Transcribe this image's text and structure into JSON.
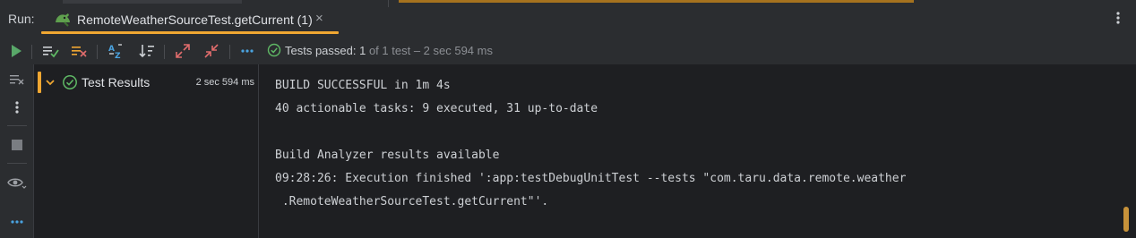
{
  "run_header": {
    "label": "Run:",
    "tab": {
      "title": "RemoteWeatherSourceTest.getCurrent (1)",
      "icon": "android-test-icon",
      "close_glyph": "×"
    },
    "menu_icon": "kebab-menu-icon"
  },
  "toolbar": {
    "buttons": [
      {
        "name": "rerun-button",
        "icon": "play-icon"
      },
      {
        "name": "show-passed-button",
        "icon": "show-passed-icon"
      },
      {
        "name": "show-ignored-button",
        "icon": "show-ignored-icon"
      },
      {
        "name": "sort-alphabetically-button",
        "icon": "sort-az-icon"
      },
      {
        "name": "sort-by-duration-button",
        "icon": "sort-duration-icon"
      },
      {
        "name": "expand-all-button",
        "icon": "expand-icon"
      },
      {
        "name": "collapse-all-button",
        "icon": "collapse-icon"
      },
      {
        "name": "more-actions-button",
        "icon": "more-horizontal-icon"
      }
    ],
    "status": {
      "prefix": "Tests passed: ",
      "count": "1",
      "suffix": " of 1 test – 2 sec 594 ms"
    }
  },
  "left_strip": {
    "buttons": [
      "clear-all-icon",
      "kebab-menu-icon",
      "stop-icon",
      "view-icon",
      "more-horizontal-icon"
    ]
  },
  "tree": {
    "root": {
      "label": "Test Results",
      "time": "2 sec 594 ms",
      "status": "passed"
    }
  },
  "console": {
    "lines": [
      "BUILD SUCCESSFUL in 1m 4s",
      "40 actionable tasks: 9 executed, 31 up-to-date",
      "",
      "Build Analyzer results available",
      "09:28:26: Execution finished ':app:testDebugUnitTest --tests \"com.taru.data.remote.weather",
      " .RemoteWeatherSourceTest.getCurrent\"'."
    ]
  },
  "colors": {
    "accent_orange": "#f0a732",
    "success_green": "#5fb865",
    "play_green": "#59a869",
    "link_blue": "#4aa3e0",
    "icon_red": "#e06c6c"
  }
}
